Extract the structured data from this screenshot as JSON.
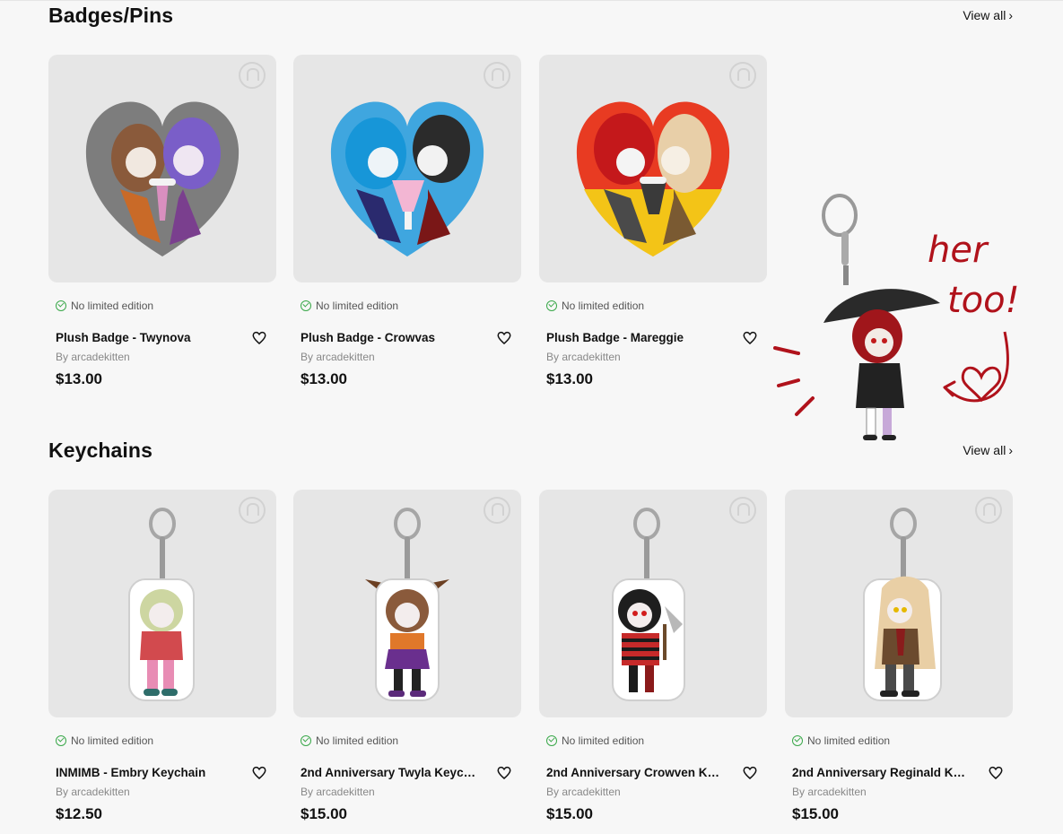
{
  "colors": {
    "background": "#f7f7f7",
    "thumb_bg": "#e6e6e6",
    "check_green": "#3aa84a",
    "annotation_red": "#b0121b"
  },
  "sections": [
    {
      "title": "Badges/Pins",
      "view_all": "View all",
      "products": [
        {
          "limited": "No limited edition",
          "name": "Plush Badge - Twynova",
          "by": "By arcadekitten",
          "price": "$13.00",
          "image": "heart-badge-gray"
        },
        {
          "limited": "No limited edition",
          "name": "Plush Badge - Crowvas",
          "by": "By arcadekitten",
          "price": "$13.00",
          "image": "heart-badge-blue"
        },
        {
          "limited": "No limited edition",
          "name": "Plush Badge - Mareggie",
          "by": "By arcadekitten",
          "price": "$13.00",
          "image": "heart-badge-red"
        }
      ]
    },
    {
      "title": "Keychains",
      "view_all": "View all",
      "products": [
        {
          "limited": "No limited edition",
          "name": "INMIMB - Embry Keychain",
          "by": "By arcadekitten",
          "price": "$12.50",
          "image": "keychain-embry"
        },
        {
          "limited": "No limited edition",
          "name": "2nd Anniversary Twyla Keyc…",
          "by": "By arcadekitten",
          "price": "$15.00",
          "image": "keychain-twyla"
        },
        {
          "limited": "No limited edition",
          "name": "2nd Anniversary Crowven K…",
          "by": "By arcadekitten",
          "price": "$15.00",
          "image": "keychain-crowven"
        },
        {
          "limited": "No limited edition",
          "name": "2nd Anniversary Reginald K…",
          "by": "By arcadekitten",
          "price": "$15.00",
          "image": "keychain-reginald"
        }
      ]
    }
  ],
  "annotation": {
    "line1": "her",
    "line2": "too!"
  },
  "icons": [
    "check-circle-icon",
    "heart-outline-icon",
    "chevron-right-icon",
    "watermark-logo-icon"
  ]
}
